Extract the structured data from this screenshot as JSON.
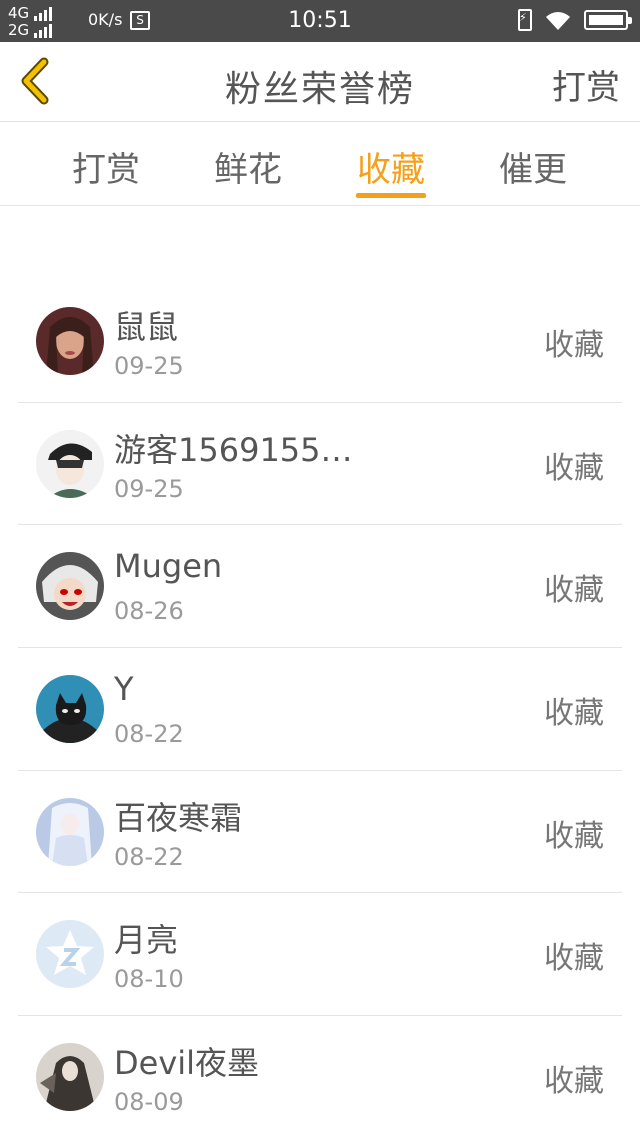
{
  "status_bar": {
    "net_top": "4G",
    "net_bottom": "2G",
    "speed": "0K/s",
    "sim_badge": "S",
    "time": "10:51",
    "icons": [
      "signal-bars-icon",
      "charging-icon",
      "wifi-icon",
      "battery-icon"
    ]
  },
  "header": {
    "title": "粉丝荣誉榜",
    "right_action": "打赏",
    "back_icon": "chevron-left-icon",
    "back_color": "#f5c000"
  },
  "tabs": [
    {
      "label": "打赏",
      "active": false
    },
    {
      "label": "鲜花",
      "active": false
    },
    {
      "label": "收藏",
      "active": true
    },
    {
      "label": "催更",
      "active": false
    }
  ],
  "accent_color": "#f5a01a",
  "fans": [
    {
      "name": "鼠鼠",
      "date": "09-25",
      "action": "收藏",
      "avatar": "portrait-photo"
    },
    {
      "name": "游客1569155…",
      "date": "09-25",
      "action": "收藏",
      "avatar": "cartoon-boy-cap"
    },
    {
      "name": "Mugen",
      "date": "08-26",
      "action": "收藏",
      "avatar": "anime-character"
    },
    {
      "name": "Y",
      "date": "08-22",
      "action": "收藏",
      "avatar": "black-cat"
    },
    {
      "name": "百夜寒霜",
      "date": "08-22",
      "action": "收藏",
      "avatar": "anime-girl-white"
    },
    {
      "name": "月亮",
      "date": "08-10",
      "action": "收藏",
      "avatar": "default-star-avatar"
    },
    {
      "name": "Devil夜墨",
      "date": "08-09",
      "action": "收藏",
      "avatar": "dark-anime-figure"
    }
  ]
}
